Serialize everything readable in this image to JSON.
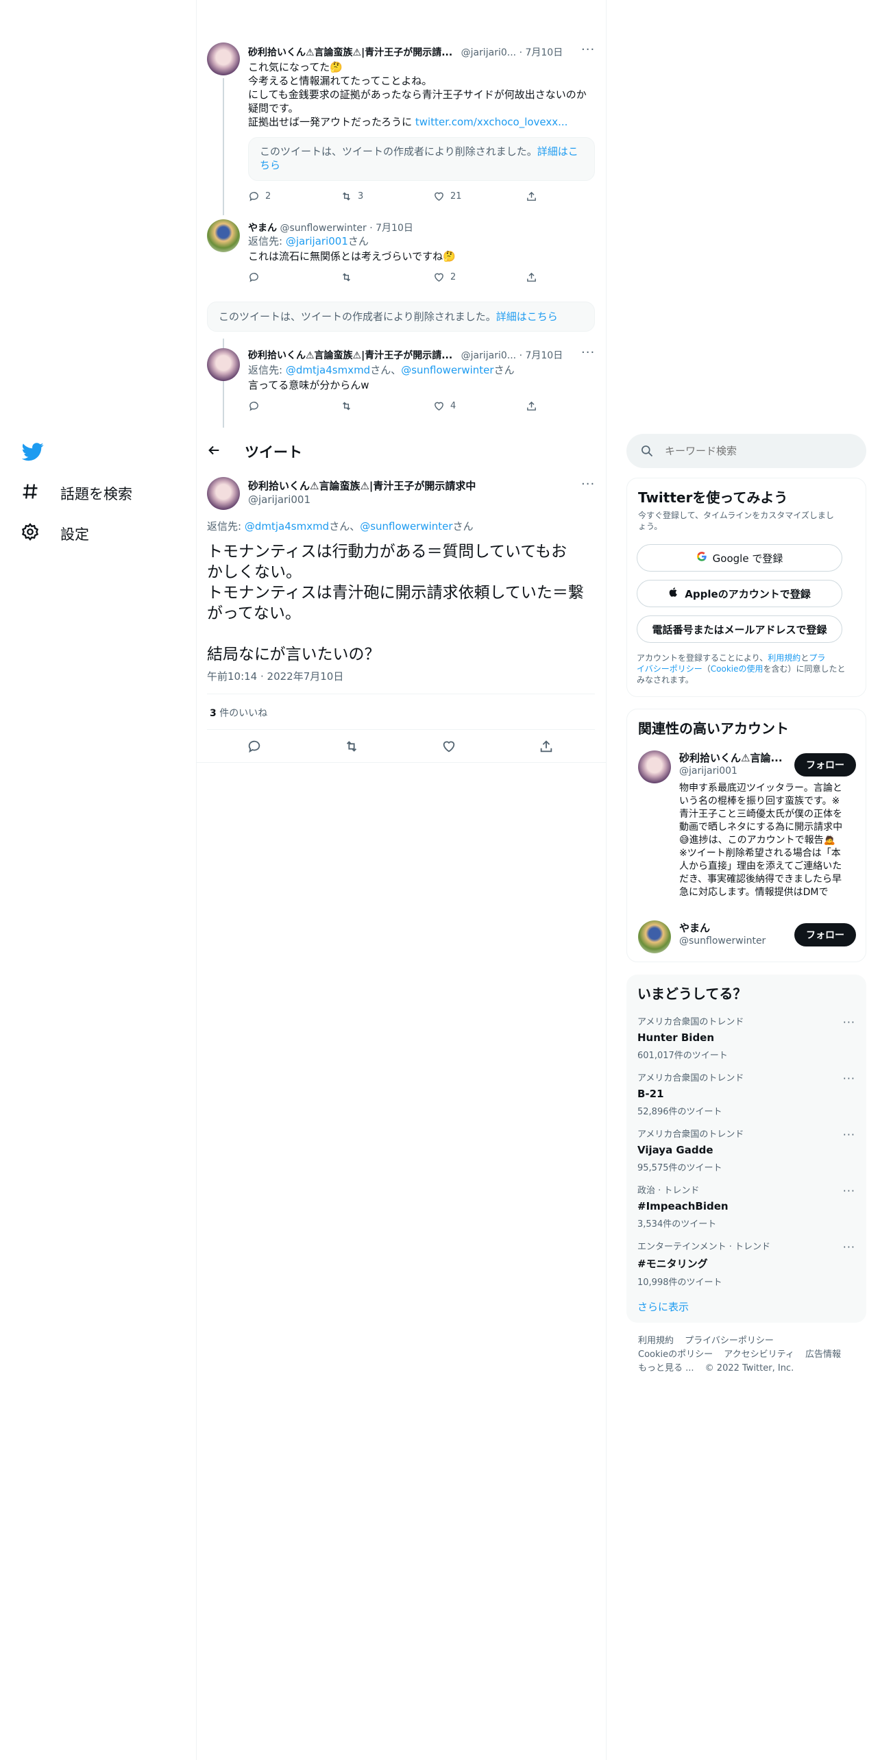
{
  "nav": {
    "explore": "話題を検索",
    "settings": "設定"
  },
  "thread": {
    "t1": {
      "author": "砂利拾いくん⚠言論蛮族⚠|青汁王子が開示請...",
      "handle": "@jarijari0...",
      "time": "· 7月10日",
      "line1": "これ気になってた🤔",
      "line2": "今考えると情報漏れてたってことよね。",
      "line3": "にしても金銭要求の証拠があったなら青汁王子サイドが何故出さないのか",
      "line4": "疑問です。",
      "line5": "証拠出せば一発アウトだったろうに",
      "link": "twitter.com/xxchoco_lovexx...",
      "deleted_text": "このツイートは、ツイートの作成者により削除されました。",
      "deleted_more1": "詳細はこ",
      "deleted_more2": "ちら",
      "replies": "2",
      "retweets": "3",
      "likes": "21"
    },
    "t2": {
      "author": "やまん",
      "handle": "@sunflowerwinter",
      "time": "· 7月10日",
      "reply_prefix": "返信先:",
      "reply_to": "@jarijari001",
      "reply_suffix": "さん",
      "text": "これは流石に無関係とは考えづらいですね🤔",
      "likes": "2"
    },
    "deleted": {
      "text": "このツイートは、ツイートの作成者により削除されました。",
      "more": "詳細はこちら"
    },
    "t3": {
      "author": "砂利拾いくん⚠言論蛮族⚠|青汁王子が開示請...",
      "handle": "@jarijari0...",
      "time": "· 7月10日",
      "reply_prefix": "返信先:",
      "reply_to1": "@dmtja4smxmd",
      "reply_mid": "さん、",
      "reply_to2": "@sunflowerwinter",
      "reply_suffix": "さん",
      "text": "言ってる意味が分からんw",
      "likes": "4"
    }
  },
  "header": {
    "title": "ツイート"
  },
  "main_tweet": {
    "author": "砂利拾いくん⚠言論蛮族⚠|青汁王子が開示請求中",
    "handle": "@jarijari001",
    "reply_prefix": "返信先:",
    "reply_to1": "@dmtja4smxmd",
    "reply_mid": "さん、",
    "reply_to2": "@sunflowerwinter",
    "reply_suffix": "さん",
    "line1": "トモナンティスは行動力がある＝質問していてもお",
    "line2": "かしくない。",
    "line3": "トモナンティスは青汁砲に開示請求依頼していた＝繋",
    "line4": "がってない。",
    "line5": "結局なにが言いたいの？",
    "timestamp": "午前10:14 · 2022年7月10日",
    "likes_count": "3",
    "likes_label": "件のいいね"
  },
  "search": {
    "placeholder": "キーワード検索"
  },
  "signup": {
    "title": "Twitterを使ってみよう",
    "desc1": "今すぐ登録して、タイムラインをカスタマイズしまし",
    "desc2": "ょう。",
    "google": "Google で登録",
    "apple": "Appleのアカウントで登録",
    "phone": "電話番号またはメールアドレスで登録",
    "terms1a": "アカウントを登録することにより、",
    "terms1b": "利用規約",
    "terms1c": "と",
    "terms1d": "プラ",
    "terms2a": "イバシーポリシー",
    "terms2b": "（",
    "terms2c": "Cookieの使用",
    "terms2d": "を含む）に同意したと",
    "terms3": "みなされます。"
  },
  "related": {
    "title": "関連性の高いアカウント",
    "a1": {
      "name": "砂利拾いくん⚠言論...",
      "handle": "@jarijari001",
      "follow": "フォロー",
      "bio": [
        "物申す系最底辺ツイッタラー。言論と",
        "いう名の棍棒を振り回す蛮族です。※",
        "青汁王子こと三崎優太氏が僕の正体を",
        "動画で晒しネタにする為に開示請求中",
        "😅進捗は、このアカウントで報告🙇",
        "※ツイート削除希望される場合は「本",
        "人から直接」理由を添えてご連絡いた",
        "だき、事実確認後納得できましたら早",
        "急に対応します。情報提供はDMで"
      ]
    },
    "a2": {
      "name": "やまん",
      "handle": "@sunflowerwinter",
      "follow": "フォロー"
    }
  },
  "trends": {
    "title": "いまどうしてる？",
    "items": [
      {
        "cat": "アメリカ合衆国のトレンド",
        "name": "Hunter Biden",
        "count": "601,017件のツイート"
      },
      {
        "cat": "アメリカ合衆国のトレンド",
        "name": "B-21",
        "count": "52,896件のツイート"
      },
      {
        "cat": "アメリカ合衆国のトレンド",
        "name": "Vijaya Gadde",
        "count": "95,575件のツイート"
      },
      {
        "cat": "政治 · トレンド",
        "name": "#ImpeachBiden",
        "count": "3,534件のツイート"
      },
      {
        "cat": "エンターテインメント · トレンド",
        "name": "#モニタリング",
        "count": "10,998件のツイート"
      }
    ],
    "show_more": "さらに表示"
  },
  "footer": {
    "terms": "利用規約",
    "privacy": "プライバシーポリシー",
    "cookie": "Cookieのポリシー",
    "accessibility": "アクセシビリティ",
    "ads": "広告情報",
    "more": "もっと見る ...",
    "copyright": "© 2022 Twitter, Inc."
  },
  "colors": {
    "accent": "#1d9bf0",
    "text": "#0f1419",
    "muted": "#536471",
    "border": "#eff3f4"
  }
}
